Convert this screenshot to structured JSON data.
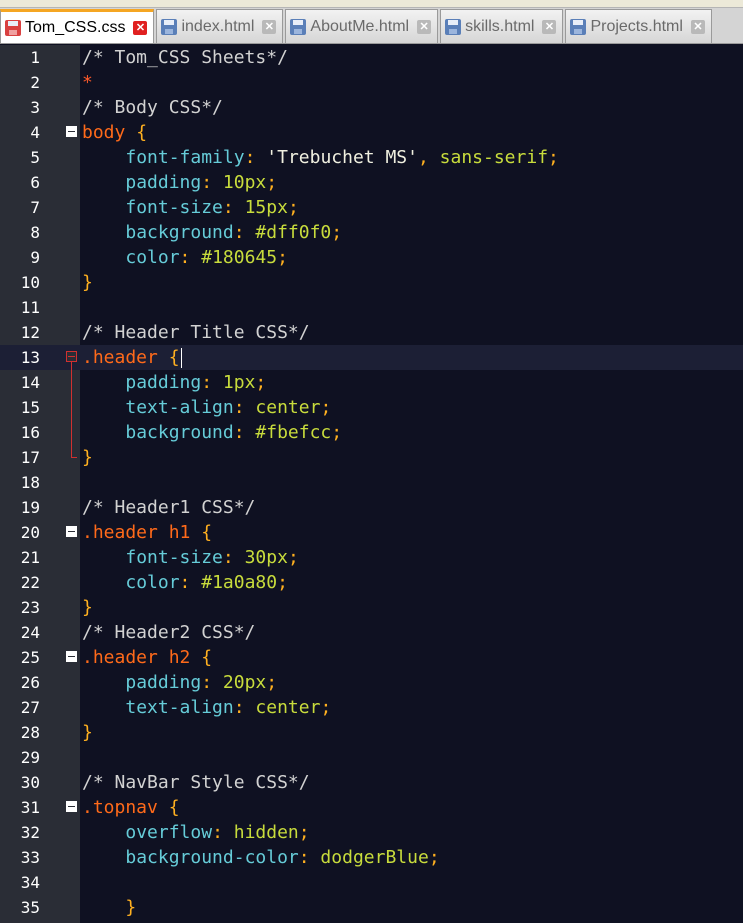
{
  "tabs": [
    {
      "label": "Tom_CSS.css",
      "active": true,
      "icon": "red-save-icon"
    },
    {
      "label": "index.html",
      "active": false,
      "icon": "save-icon"
    },
    {
      "label": "AboutMe.html",
      "active": false,
      "icon": "save-icon"
    },
    {
      "label": "skills.html",
      "active": false,
      "icon": "save-icon"
    },
    {
      "label": "Projects.html",
      "active": false,
      "icon": "save-icon"
    }
  ],
  "tab_close_glyph": "✕",
  "current_line": 13,
  "lines": [
    {
      "n": "1",
      "text": "/* Tom_CSS Sheets*/"
    },
    {
      "n": "2",
      "text": "*"
    },
    {
      "n": "3",
      "text": "/* Body CSS*/"
    },
    {
      "n": "4",
      "text": "body {"
    },
    {
      "n": "5",
      "text": "    font-family: 'Trebuchet MS', sans-serif;"
    },
    {
      "n": "6",
      "text": "    padding: 10px;"
    },
    {
      "n": "7",
      "text": "    font-size: 15px;"
    },
    {
      "n": "8",
      "text": "    background: #dff0f0;"
    },
    {
      "n": "9",
      "text": "    color: #180645;"
    },
    {
      "n": "10",
      "text": "}"
    },
    {
      "n": "11",
      "text": ""
    },
    {
      "n": "12",
      "text": "/* Header Title CSS*/"
    },
    {
      "n": "13",
      "text": ".header {"
    },
    {
      "n": "14",
      "text": "    padding: 1px;"
    },
    {
      "n": "15",
      "text": "    text-align: center;"
    },
    {
      "n": "16",
      "text": "    background: #fbefcc;"
    },
    {
      "n": "17",
      "text": "}"
    },
    {
      "n": "18",
      "text": ""
    },
    {
      "n": "19",
      "text": "/* Header1 CSS*/"
    },
    {
      "n": "20",
      "text": ".header h1 {"
    },
    {
      "n": "21",
      "text": "    font-size: 30px;"
    },
    {
      "n": "22",
      "text": "    color: #1a0a80;"
    },
    {
      "n": "23",
      "text": "}"
    },
    {
      "n": "24",
      "text": "/* Header2 CSS*/"
    },
    {
      "n": "25",
      "text": ".header h2 {"
    },
    {
      "n": "26",
      "text": "    padding: 20px;"
    },
    {
      "n": "27",
      "text": "    text-align: center;"
    },
    {
      "n": "28",
      "text": "}"
    },
    {
      "n": "29",
      "text": ""
    },
    {
      "n": "30",
      "text": "/* NavBar Style CSS*/"
    },
    {
      "n": "31",
      "text": ".topnav {"
    },
    {
      "n": "32",
      "text": "    overflow: hidden;"
    },
    {
      "n": "33",
      "text": "    background-color: dodgerBlue;"
    },
    {
      "n": "34",
      "text": ""
    },
    {
      "n": "35",
      "text": "    }"
    }
  ],
  "fold_markers": [
    4,
    13,
    20,
    25,
    31
  ],
  "colors": {
    "background": "#0f1122",
    "gutter": "#2a2d36",
    "comment": "#d2d2d2",
    "selector": "#ff6a1a",
    "brace": "#ffb020",
    "property": "#66ccd8",
    "value": "#c8dc3c",
    "active_tab_accent": "#f5a623"
  }
}
